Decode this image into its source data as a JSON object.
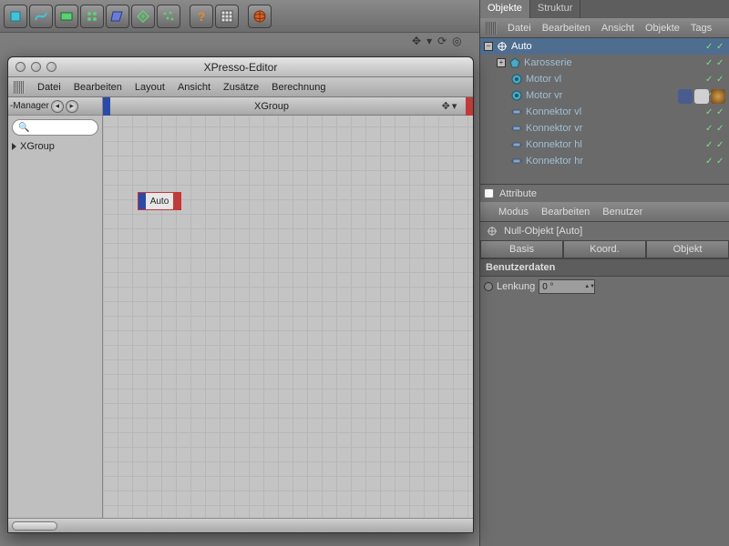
{
  "right": {
    "tabs": [
      "Objekte",
      "Struktur"
    ],
    "active_tab": 0,
    "menu": [
      "Datei",
      "Bearbeiten",
      "Ansicht",
      "Objekte",
      "Tags"
    ],
    "tree": {
      "root": {
        "label": "Auto"
      },
      "children": [
        {
          "label": "Karosserie",
          "icon": "poly"
        },
        {
          "label": "Motor vl",
          "icon": "motor"
        },
        {
          "label": "Motor vr",
          "icon": "motor"
        },
        {
          "label": "Konnektor vl",
          "icon": "conn"
        },
        {
          "label": "Konnektor vr",
          "icon": "conn"
        },
        {
          "label": "Konnektor hl",
          "icon": "conn"
        },
        {
          "label": "Konnektor hr",
          "icon": "conn"
        }
      ]
    },
    "attribute": {
      "header": "Attribute",
      "menu": [
        "Modus",
        "Bearbeiten",
        "Benutzer"
      ],
      "object_label": "Null-Objekt [Auto]",
      "tabs": [
        "Basis",
        "Koord.",
        "Objekt"
      ],
      "section": "Benutzerdaten",
      "field": {
        "label": "Lenkung",
        "value": "0 °"
      }
    }
  },
  "nav_icons": [
    "move",
    "down",
    "rotate",
    "target"
  ],
  "xpresso": {
    "title": "XPresso-Editor",
    "menu": [
      "Datei",
      "Bearbeiten",
      "Layout",
      "Ansicht",
      "Zusätze",
      "Berechnung"
    ],
    "manager_tab": "-Manager",
    "search_placeholder": "",
    "tree_item": "XGroup",
    "canvas_title": "XGroup",
    "node_label": "Auto"
  }
}
